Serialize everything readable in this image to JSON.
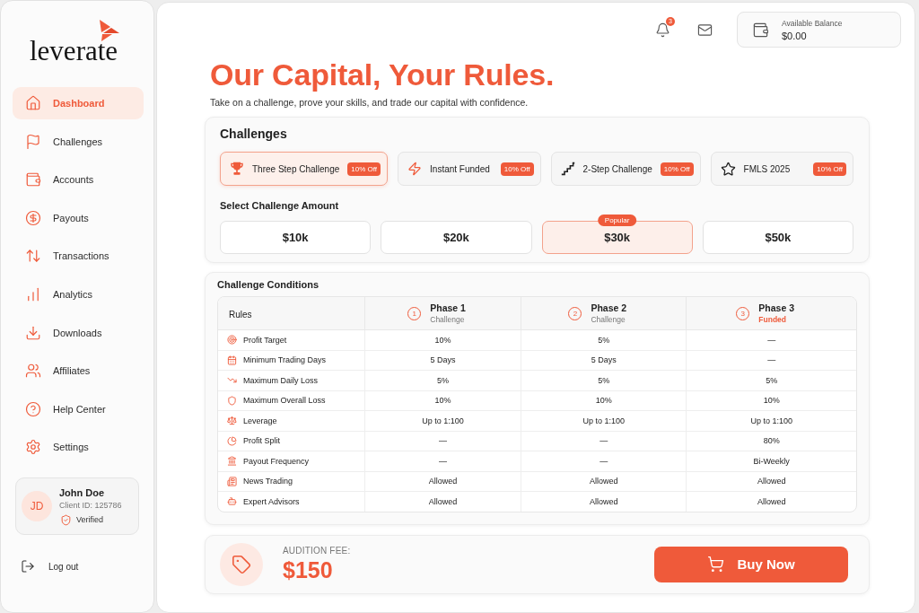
{
  "sidebar": {
    "logo": "leverate",
    "nav": [
      {
        "label": "Dashboard",
        "selected": true
      },
      {
        "label": "Challenges",
        "selected": false
      },
      {
        "label": "Accounts",
        "selected": false
      },
      {
        "label": "Payouts",
        "selected": false
      },
      {
        "label": "Transactions",
        "selected": false
      },
      {
        "label": "Analytics",
        "selected": false
      },
      {
        "label": "Downloads",
        "selected": false
      },
      {
        "label": "Affiliates",
        "selected": false
      },
      {
        "label": "Help Center",
        "selected": false
      },
      {
        "label": "Settings",
        "selected": false
      }
    ],
    "user": {
      "initials": "JD",
      "name": "John Doe",
      "client_id": "Client ID: 125786",
      "status": "Verified"
    },
    "logout": "Log out"
  },
  "header": {
    "notification_count": "3",
    "balance": {
      "label": "Available Balance",
      "value": "$0.00"
    }
  },
  "hero": {
    "title": "Our Capital, Your Rules.",
    "subtitle": "Take on a challenge, prove your skills, and trade our capital with confidence."
  },
  "challenges": {
    "title": "Challenges",
    "types": [
      {
        "label": "Three Step Challenge",
        "badge": "10% Off",
        "selected": true
      },
      {
        "label": "Instant Funded",
        "badge": "10% Off",
        "selected": false
      },
      {
        "label": "2-Step Challenge",
        "badge": "10% Off",
        "selected": false
      },
      {
        "label": "FMLS 2025",
        "badge": "10% Off",
        "selected": false
      }
    ],
    "amount_title": "Select Challenge Amount",
    "amounts": [
      {
        "label": "$10k",
        "selected": false
      },
      {
        "label": "$20k",
        "selected": false
      },
      {
        "label": "$30k",
        "selected": true,
        "badge": "Popular"
      },
      {
        "label": "$50k",
        "selected": false
      }
    ]
  },
  "conditions": {
    "title": "Challenge Conditions",
    "columns": [
      {
        "kind": "rules",
        "label": "Rules"
      },
      {
        "kind": "phase",
        "number": "1",
        "label": "Phase 1",
        "sublabel": "Challenge",
        "highlighted": false
      },
      {
        "kind": "phase",
        "number": "2",
        "label": "Phase 2",
        "sublabel": "Challenge",
        "highlighted": false
      },
      {
        "kind": "phase",
        "number": "3",
        "label": "Phase 3",
        "sublabel": "Funded",
        "highlighted": true
      }
    ],
    "rows": [
      {
        "cells": [
          "Profit Target",
          "10%",
          "5%",
          "—"
        ]
      },
      {
        "cells": [
          "Minimum Trading Days",
          "5 Days",
          "5 Days",
          "—"
        ]
      },
      {
        "cells": [
          "Maximum Daily Loss",
          "5%",
          "5%",
          "5%"
        ]
      },
      {
        "cells": [
          "Maximum Overall Loss",
          "10%",
          "10%",
          "10%"
        ]
      },
      {
        "cells": [
          "Leverage",
          "Up to 1:100",
          "Up to 1:100",
          "Up to 1:100"
        ]
      },
      {
        "cells": [
          "Profit Split",
          "—",
          "—",
          "80%"
        ]
      },
      {
        "cells": [
          "Payout Frequency",
          "—",
          "—",
          "Bi-Weekly"
        ]
      },
      {
        "cells": [
          "News Trading",
          "Allowed",
          "Allowed",
          "Allowed"
        ]
      },
      {
        "cells": [
          "Expert Advisors",
          "Allowed",
          "Allowed",
          "Allowed"
        ]
      }
    ]
  },
  "footer": {
    "fee_label": "AUDITION FEE:",
    "fee": "$150",
    "button": "Buy Now"
  }
}
